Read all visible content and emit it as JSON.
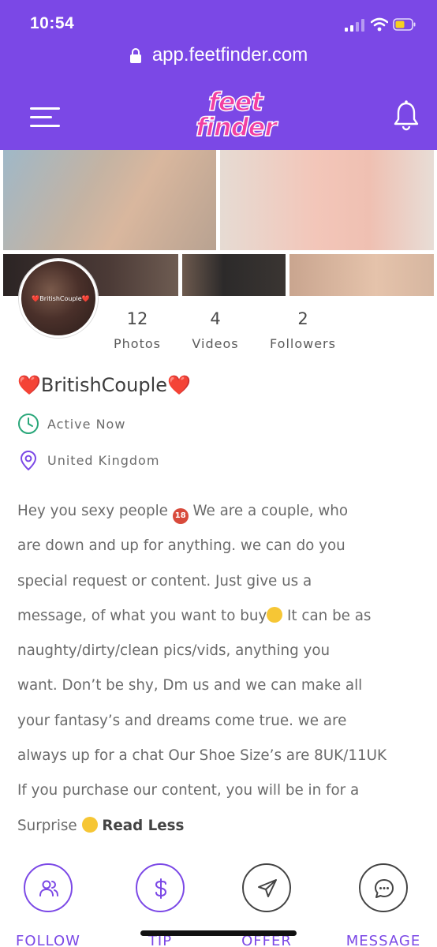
{
  "status_bar": {
    "time": "10:54"
  },
  "browser": {
    "url": "app.feetfinder.com"
  },
  "header": {
    "menu_icon": "hamburger-icon",
    "logo_line1": "feet",
    "logo_line2": "finder",
    "notification_icon": "bell-icon"
  },
  "gallery": {
    "photos": [
      "feet-photo",
      "feet-photo",
      "feet-photo",
      "feet-photo",
      "feet-photo"
    ]
  },
  "profile": {
    "avatar_watermark": "❤️BritishCouple❤️",
    "name": "❤️BritishCouple❤️",
    "status": "Active Now",
    "location": "United Kingdom",
    "stats": [
      {
        "value": "12",
        "label": "Photos"
      },
      {
        "value": "4",
        "label": "Videos"
      },
      {
        "value": "2",
        "label": "Followers"
      }
    ],
    "bio_lines": [
      "Hey you sexy people ",
      " We are a couple, who",
      "are down and up for anything. we can do you",
      "special request or content. Just give us a",
      "message, of what you want to buy",
      " It can be as",
      "naughty/dirty/clean pics/vids, anything you",
      "want. Don’t be shy, Dm us and we can make all",
      "your fantasy’s and dreams come true. we are",
      "always up for a chat Our Shoe Size’s are 8UK/11UK",
      "If you purchase our content, you will be in for a",
      "Surprise "
    ],
    "emoji_18": "18",
    "read_less": "Read Less"
  },
  "actions": [
    {
      "label": "FOLLOW",
      "icon": "follow-icon"
    },
    {
      "label": "TIP",
      "icon": "dollar-icon"
    },
    {
      "label": "OFFER",
      "icon": "send-icon"
    },
    {
      "label": "MESSAGE",
      "icon": "chat-icon"
    }
  ],
  "colors": {
    "brand_purple": "#7b48e6",
    "logo_pink": "#f23ea2",
    "active_green": "#2aa77a"
  }
}
